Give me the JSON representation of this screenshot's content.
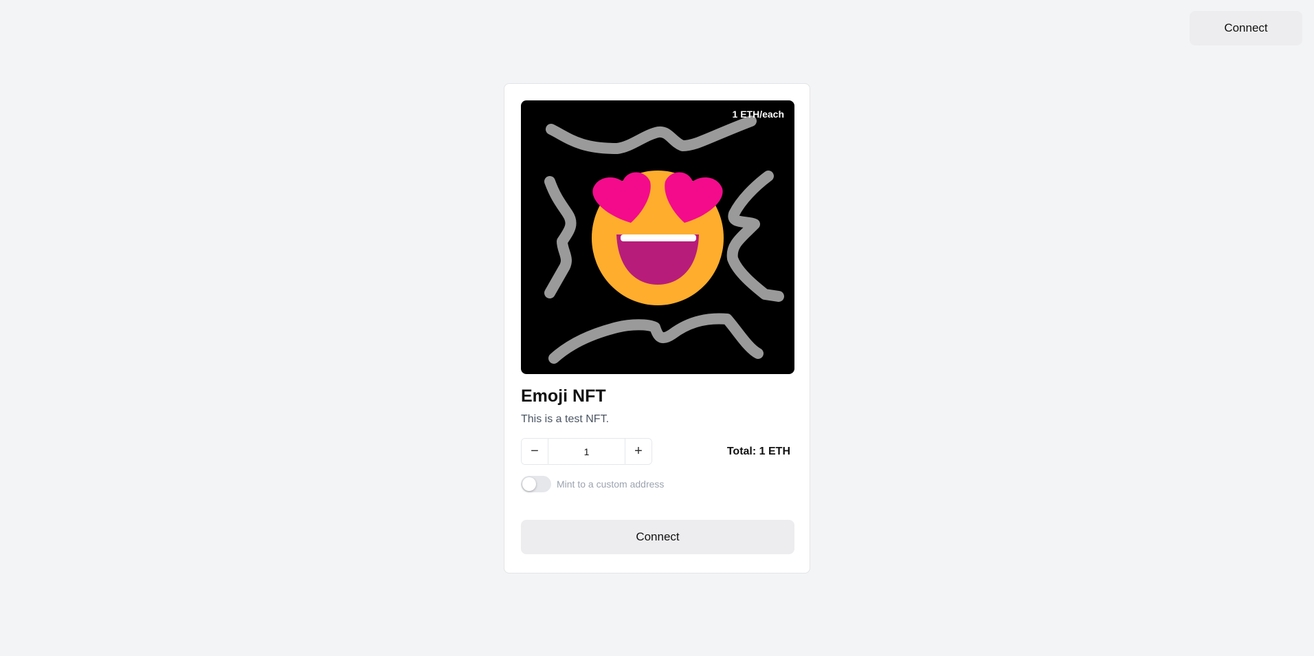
{
  "header": {
    "connect_label": "Connect"
  },
  "nft": {
    "price_badge": "1 ETH/each",
    "title": "Emoji NFT",
    "description": "This is a test NFT.",
    "quantity": "1",
    "decrement_icon": "minus-icon",
    "increment_icon": "plus-icon",
    "decrement_symbol": "−",
    "increment_symbol": "+",
    "total": "Total: 1 ETH",
    "custom_address_toggle": {
      "label": "Mint to a custom address",
      "enabled": false
    },
    "connect_label": "Connect"
  },
  "colors": {
    "background": "#f3f4f6",
    "button": "#ededef",
    "face": "#ffad2d",
    "hearts": "#f30b8c",
    "mouth": "#b81c7a",
    "scribble": "#9a9a9a"
  }
}
